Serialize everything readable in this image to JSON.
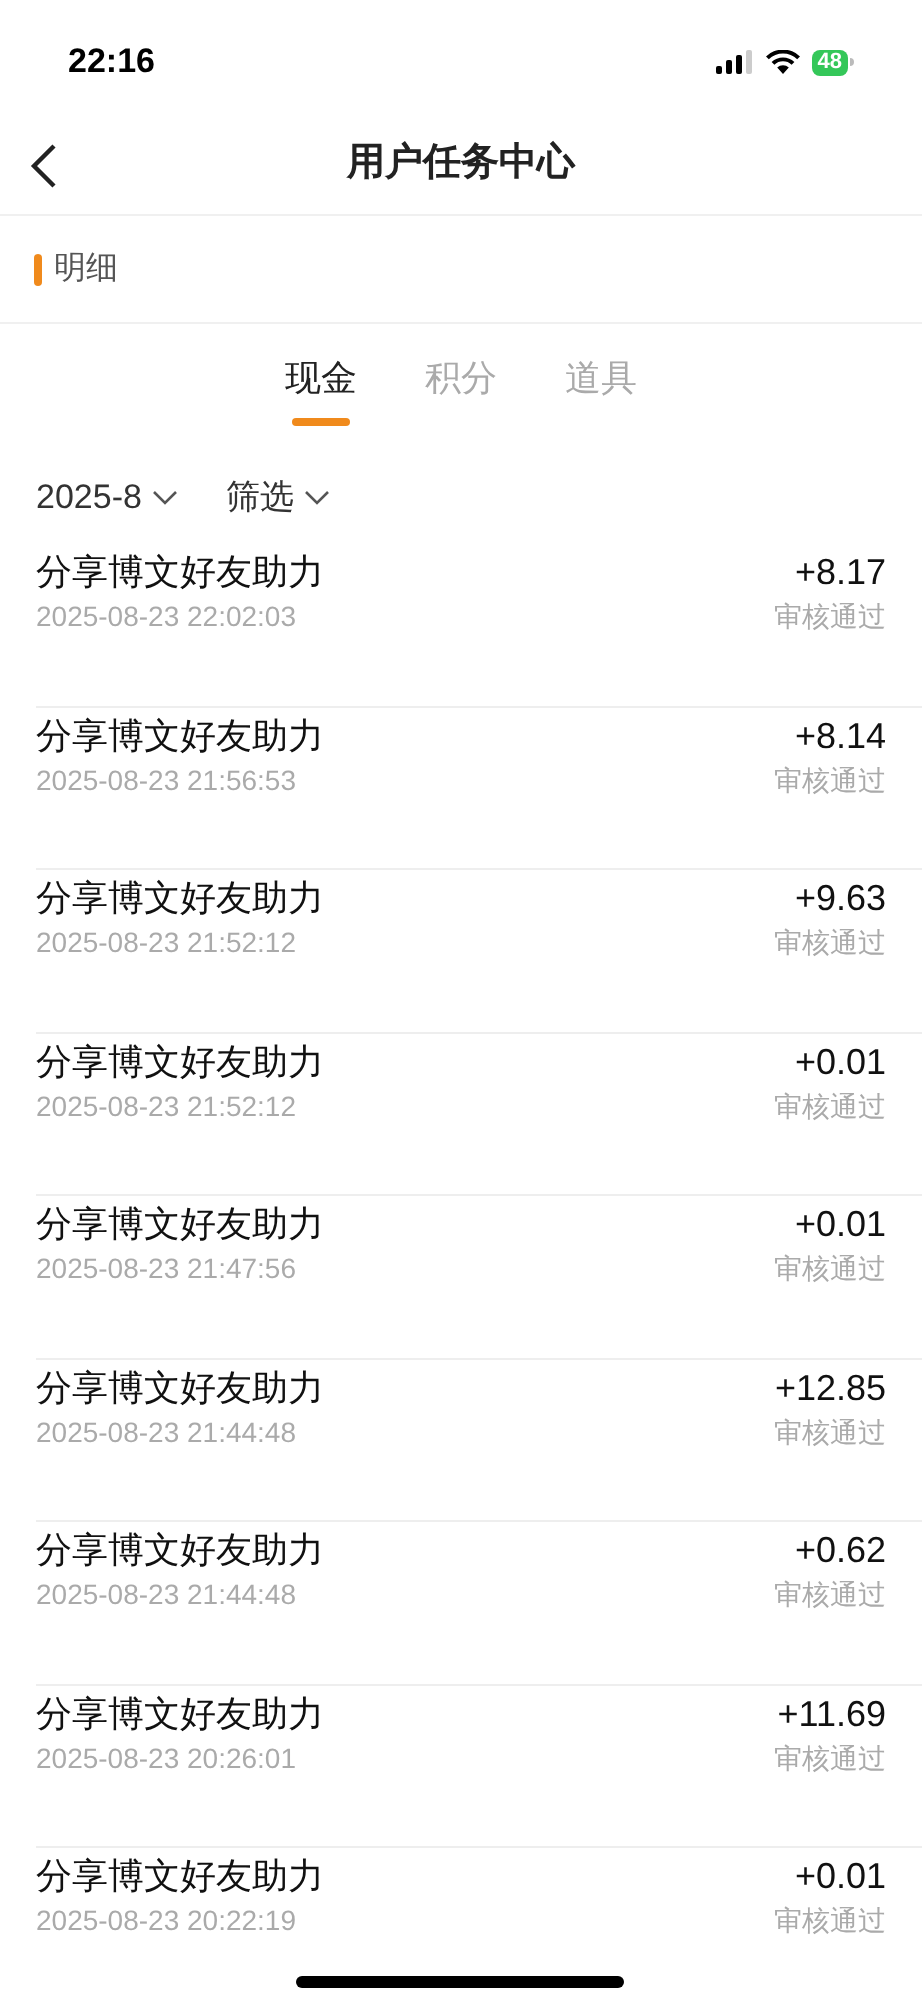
{
  "status_bar": {
    "time": "22:16",
    "battery": "48"
  },
  "nav": {
    "title": "用户任务中心"
  },
  "section": {
    "title": "明细"
  },
  "tabs": [
    {
      "label": "现金",
      "selected": true
    },
    {
      "label": "积分",
      "selected": false
    },
    {
      "label": "道具",
      "selected": false
    }
  ],
  "filters": [
    {
      "label": "2025-8"
    },
    {
      "label": "筛选"
    }
  ],
  "records": [
    {
      "title": "分享博文好友助力",
      "time": "2025-08-23 22:02:03",
      "amount": "+8.17",
      "status": "审核通过"
    },
    {
      "title": "分享博文好友助力",
      "time": "2025-08-23 21:56:53",
      "amount": "+8.14",
      "status": "审核通过"
    },
    {
      "title": "分享博文好友助力",
      "time": "2025-08-23 21:52:12",
      "amount": "+9.63",
      "status": "审核通过"
    },
    {
      "title": "分享博文好友助力",
      "time": "2025-08-23 21:52:12",
      "amount": "+0.01",
      "status": "审核通过"
    },
    {
      "title": "分享博文好友助力",
      "time": "2025-08-23 21:47:56",
      "amount": "+0.01",
      "status": "审核通过"
    },
    {
      "title": "分享博文好友助力",
      "time": "2025-08-23 21:44:48",
      "amount": "+12.85",
      "status": "审核通过"
    },
    {
      "title": "分享博文好友助力",
      "time": "2025-08-23 21:44:48",
      "amount": "+0.62",
      "status": "审核通过"
    },
    {
      "title": "分享博文好友助力",
      "time": "2025-08-23 20:26:01",
      "amount": "+11.69",
      "status": "审核通过"
    },
    {
      "title": "分享博文好友助力",
      "time": "2025-08-23 20:22:19",
      "amount": "+0.01",
      "status": "审核通过"
    }
  ]
}
